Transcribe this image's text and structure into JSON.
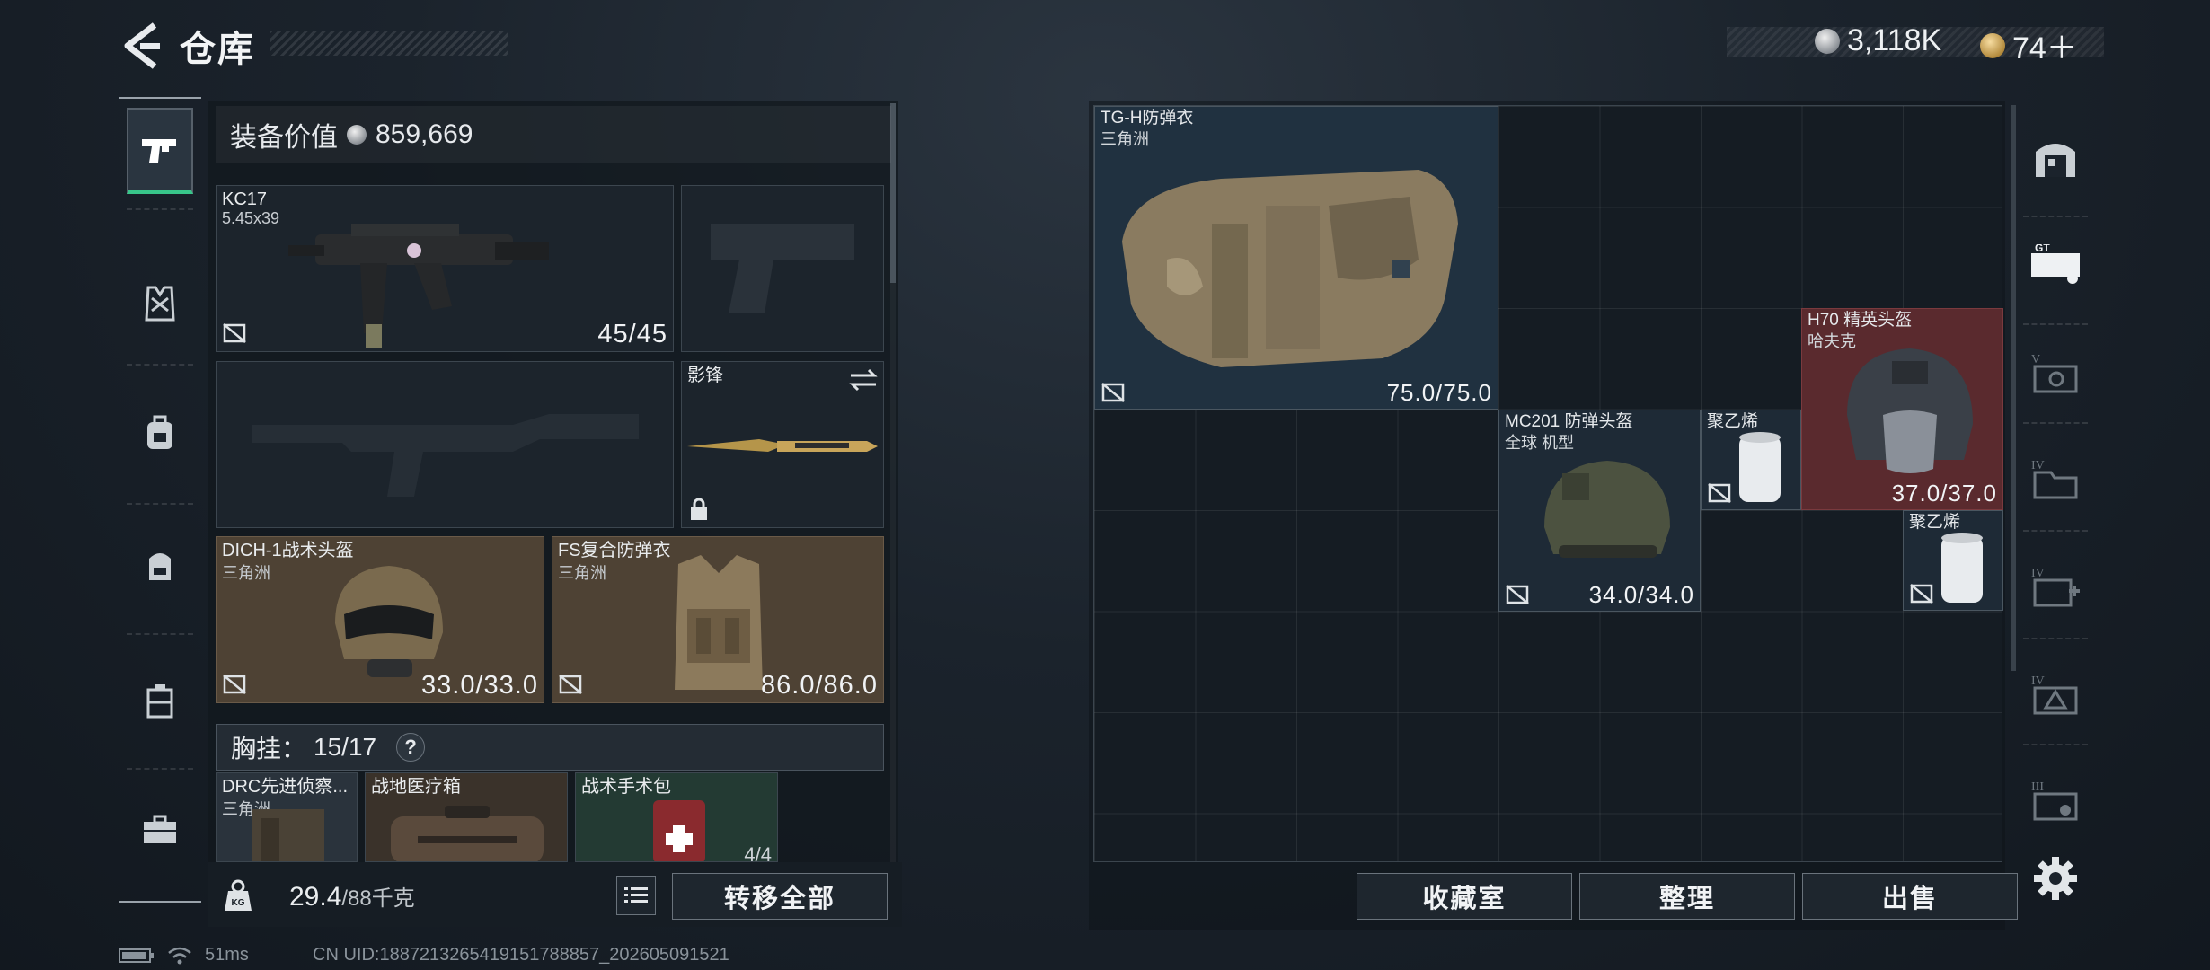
{
  "header": {
    "title": "仓库",
    "currency_silver": "3,118K",
    "currency_gold": "74＋"
  },
  "equipment": {
    "value_label": "装备价值",
    "value": "859,669",
    "primary_weapon": {
      "name": "KC17",
      "caliber": "5.45x39",
      "ammo": "45/45"
    },
    "melee": {
      "name": "影锋"
    },
    "helmet": {
      "name": "DICH-1战术头盔",
      "source": "三角洲",
      "durability": "33.0/33.0"
    },
    "armor": {
      "name": "FS复合防弹衣",
      "source": "三角洲",
      "durability": "86.0/86.0"
    },
    "chest_rig": {
      "label": "胸挂：",
      "count": "15/17",
      "help": "?"
    },
    "rig_items": [
      {
        "name": "DRC先进侦察...",
        "source": "三角洲"
      },
      {
        "name": "战地医疗箱"
      },
      {
        "name": "战术手术包",
        "count": "4/4"
      }
    ],
    "weight": "29.4",
    "weight_max": "/88千克",
    "transfer_all": "转移全部"
  },
  "stash": {
    "items": [
      {
        "name": "TG-H防弹衣",
        "source": "三角洲",
        "durability": "75.0/75.0"
      },
      {
        "name": "MC201 防弹头盔",
        "source": "全球 机型",
        "durability": "34.0/34.0"
      },
      {
        "name": "聚乙烯"
      },
      {
        "name": "H70 精英头盔",
        "source": "哈夫克",
        "durability": "37.0/37.0"
      },
      {
        "name": "聚乙烯"
      }
    ],
    "buttons": {
      "collection": "收藏室",
      "organize": "整理",
      "sell": "出售"
    }
  },
  "footer": {
    "ping": "51ms",
    "uid": "CN UID:1887213265419151788857_202605091521"
  },
  "colors": {
    "accent_green": "#38c68a",
    "rarity_red": "#5a2a2e",
    "rarity_gold": "#4e4234"
  }
}
